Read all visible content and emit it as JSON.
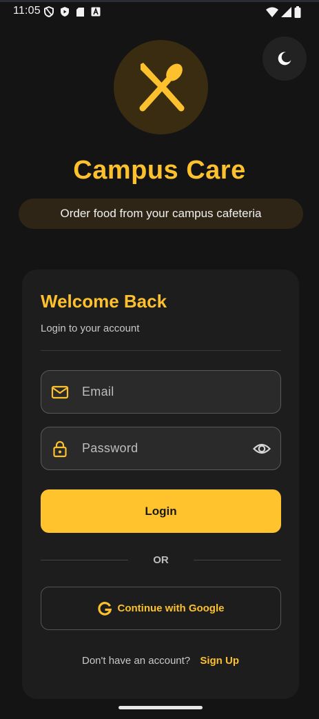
{
  "status_bar": {
    "time": "11:05",
    "left_icons": [
      "vpn-shield-icon",
      "play-protect-icon",
      "sd-card-icon",
      "keyboard-a-icon"
    ],
    "right_icons": [
      "wifi-icon",
      "cell-signal-icon",
      "battery-icon"
    ]
  },
  "header": {
    "logo_icon": "fork-spoon-icon",
    "theme_toggle_icon": "moon-icon",
    "app_title": "Campus Care",
    "tagline": "Order food from your campus cafeteria"
  },
  "login_card": {
    "title": "Welcome Back",
    "subtitle": "Login to your account",
    "email": {
      "placeholder": "Email",
      "value": "",
      "icon": "mail-icon"
    },
    "password": {
      "placeholder": "Password",
      "value": "",
      "icon": "lock-icon",
      "toggle_icon": "eye-icon"
    },
    "login_label": "Login",
    "divider_text": "OR",
    "google_label": "Continue with Google",
    "signup_prompt": "Don't have an account?",
    "signup_link": "Sign Up"
  },
  "colors": {
    "background": "#141414",
    "card": "#1d1d1d",
    "accent": "#fcc12d",
    "button": "#fec32d"
  }
}
